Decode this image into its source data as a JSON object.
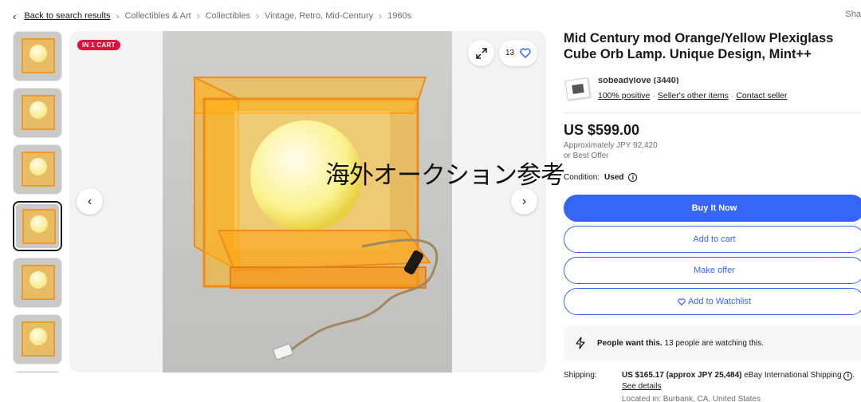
{
  "breadcrumb": {
    "back": "Back to search results",
    "items": [
      "Collectibles & Art",
      "Collectibles",
      "Vintage, Retro, Mid-Century",
      "1960s"
    ]
  },
  "share_label": "Sha",
  "gallery": {
    "badge": "IN 1 CART",
    "watch_count": "13"
  },
  "overlay_text": "海外オークション参考",
  "listing": {
    "title": "Mid Century mod Orange/Yellow Plexiglass Cube Orb Lamp. Unique Design, Mint++",
    "seller": {
      "name": "sobeadylove (3440)",
      "positive": "100% positive",
      "other_items": "Seller's other items",
      "contact": "Contact seller"
    },
    "price": "US $599.00",
    "approx": "Approximately JPY 92,420",
    "best_offer": "or Best Offer",
    "condition_label": "Condition:",
    "condition_value": "Used",
    "buttons": {
      "buy": "Buy It Now",
      "cart": "Add to cart",
      "offer": "Make offer",
      "watch": "Add to Watchlist"
    },
    "people": {
      "bold": "People want this.",
      "rest": "13 people are watching this."
    },
    "shipping": {
      "label": "Shipping:",
      "price": "US $165.17 (approx JPY 25,484)",
      "method": "eBay International Shipping",
      "see_details": "See details",
      "located": "Located in: Burbank, CA, United States"
    }
  },
  "colors": {
    "accent": "#3665f3",
    "badge": "#e0103a"
  }
}
